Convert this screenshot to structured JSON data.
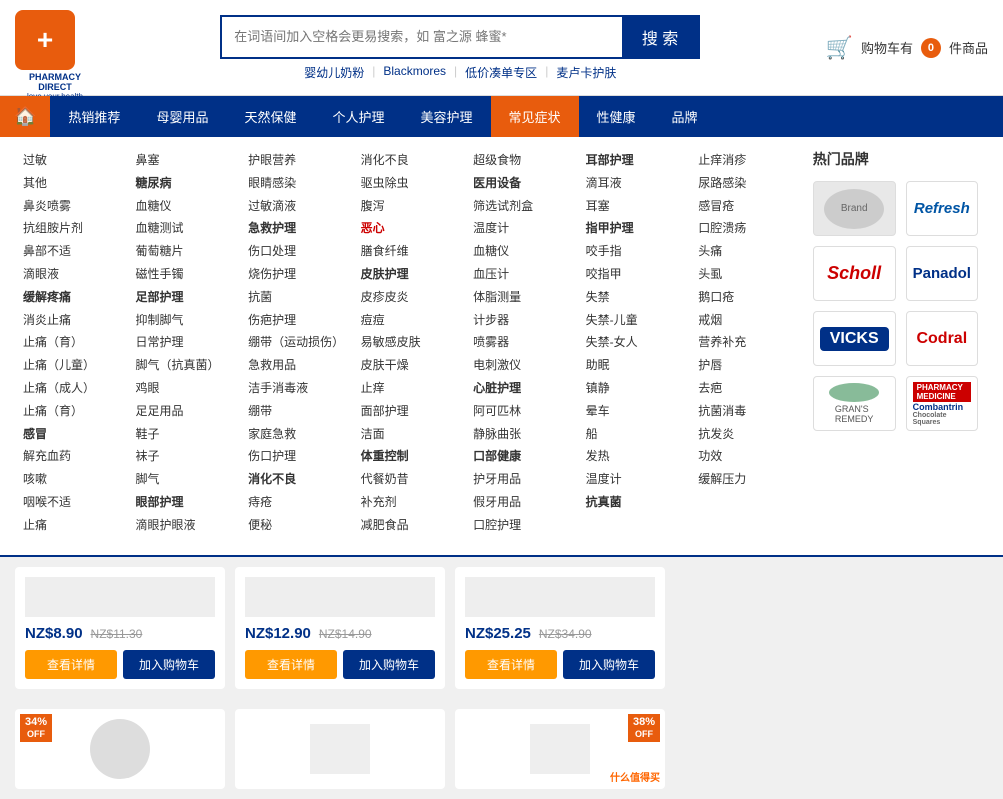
{
  "header": {
    "logo_lines": [
      "PHARMACY",
      "DIRECT"
    ],
    "tagline": "love.your.health",
    "search_placeholder": "在词语间加入空格会更易搜索，如 富之源 蜂蜜*",
    "search_btn_label": "搜 索",
    "quick_links": [
      "婴幼儿奶粉",
      "Blackmores",
      "低价凑单专区",
      "麦卢卡护肤"
    ],
    "cart_label": "购物车有",
    "cart_count": "0",
    "cart_suffix": "件商品"
  },
  "nav": {
    "home_icon": "🏠",
    "items": [
      {
        "label": "热销推荐",
        "active": false
      },
      {
        "label": "母婴用品",
        "active": false
      },
      {
        "label": "天然保健",
        "active": false
      },
      {
        "label": "个人护理",
        "active": false
      },
      {
        "label": "美容护理",
        "active": false
      },
      {
        "label": "常见症状",
        "active": true
      },
      {
        "label": "性健康",
        "active": false
      },
      {
        "label": "品牌",
        "active": false
      }
    ]
  },
  "menu_columns": {
    "col1": {
      "items": [
        "过敏",
        "其他",
        "鼻炎喷雾",
        "抗组胺片剂",
        "鼻部不适",
        "滴眼液",
        "缓解疼痛",
        "消炎止痛",
        "止痛（育）",
        "止痛（儿童）",
        "止痛（成人）",
        "止痛（育）",
        "感冒",
        "解充血药",
        "咳嗽",
        "咽喉不适",
        "止痛"
      ],
      "bold": []
    },
    "col2": {
      "items": [
        "鼻塞",
        "糖尿病",
        "血糖仪",
        "血糖测试",
        "葡萄糖片",
        "磁性手镯",
        "足部护理",
        "抑制脚气",
        "日常护理",
        "脚气（抗真菌）",
        "鸡眼",
        "足足用品",
        "鞋子",
        "袜子",
        "脚气",
        "眼部护理",
        "滴眼护眼液"
      ],
      "bold": [
        "糖尿病",
        "足部护理",
        "眼部护理"
      ]
    },
    "col3": {
      "items": [
        "护眼营养",
        "眼睛感染",
        "过敏滴液",
        "急救护理",
        "伤口处理",
        "烧伤护理",
        "抗菌",
        "伤疤护理",
        "绷带（运动损伤）",
        "急救用品",
        "洁手消毒液",
        "绷带",
        "家庭急救",
        "伤口护理",
        "消化不良",
        "痔疮",
        "便秘"
      ],
      "bold": [
        "急救护理",
        "消化不良"
      ]
    },
    "col4": {
      "items": [
        "消化不良",
        "驱虫除虫",
        "腹泻",
        "恶心",
        "膳食纤维",
        "皮肤护理",
        "皮疹皮炎",
        "痘痘",
        "易敏感皮肤",
        "皮肤干燥",
        "止痒",
        "面部护理",
        "洁面",
        "体重控制",
        "代餐奶昔",
        "补充剂",
        "减肥食品"
      ],
      "bold": [
        "皮肤护理",
        "体重控制"
      ],
      "red": [
        "恶心"
      ]
    },
    "col5": {
      "items": [
        "超级食物",
        "医用设备",
        "筛选试剂盒",
        "温度计",
        "血糖仪",
        "血压计",
        "体脂测量",
        "计步器",
        "喷雾器",
        "电刺激仪",
        "心脏护理",
        "阿可匹林",
        "静脉曲张",
        "口部健康",
        "护牙用品",
        "假牙用品",
        "口腔护理"
      ],
      "bold": [
        "医用设备",
        "心脏护理"
      ]
    },
    "col6": {
      "items": [
        "耳部护理",
        "滴耳液",
        "耳塞",
        "指甲护理",
        "咬手指",
        "咬指甲",
        "失禁",
        "失禁-儿童",
        "失禁-女人",
        "助眠",
        "镇静",
        "晕车",
        "船",
        "发热",
        "温度计",
        "抗真菌"
      ],
      "bold": [
        "指甲护理"
      ]
    },
    "col7": {
      "items": [
        "止痒消疹",
        "尿路感染",
        "感冒疮",
        "口腔溃疡",
        "头痛",
        "头虱",
        "鹅口疮",
        "戒烟",
        "营养补充",
        "护唇",
        "去疤",
        "抗菌消毒",
        "抗发炎",
        "功效",
        "缓解压力"
      ]
    },
    "brands_title": "热门品牌",
    "brands": [
      {
        "name": "Refresh",
        "style": "refresh"
      },
      {
        "name": "Scholl",
        "style": "scholl"
      },
      {
        "name": "Panadol",
        "style": "panadol"
      },
      {
        "name": "VICKS",
        "style": "vicks"
      },
      {
        "name": "Codral",
        "style": "codral"
      },
      {
        "name": "GRAN'S REMEDY",
        "style": "grans"
      },
      {
        "name": "Combantrin",
        "style": "combantrin"
      }
    ]
  },
  "products": [
    {
      "price_current": "NZ$8.90",
      "price_old": "NZ$11.30",
      "btn_detail": "查看详情",
      "btn_cart": "加入购物车"
    },
    {
      "price_current": "NZ$12.90",
      "price_old": "NZ$14.90",
      "btn_detail": "查看详情",
      "btn_cart": "加入购物车"
    },
    {
      "price_current": "NZ$25.25",
      "price_old": "NZ$34.90",
      "btn_detail": "查看详情",
      "btn_cart": "加入购物车"
    }
  ],
  "bottom_products": [
    {
      "discount": "34%",
      "off": "OFF"
    },
    {
      "discount": "38%",
      "off": "OFF"
    }
  ],
  "watermark": "什么值得买"
}
